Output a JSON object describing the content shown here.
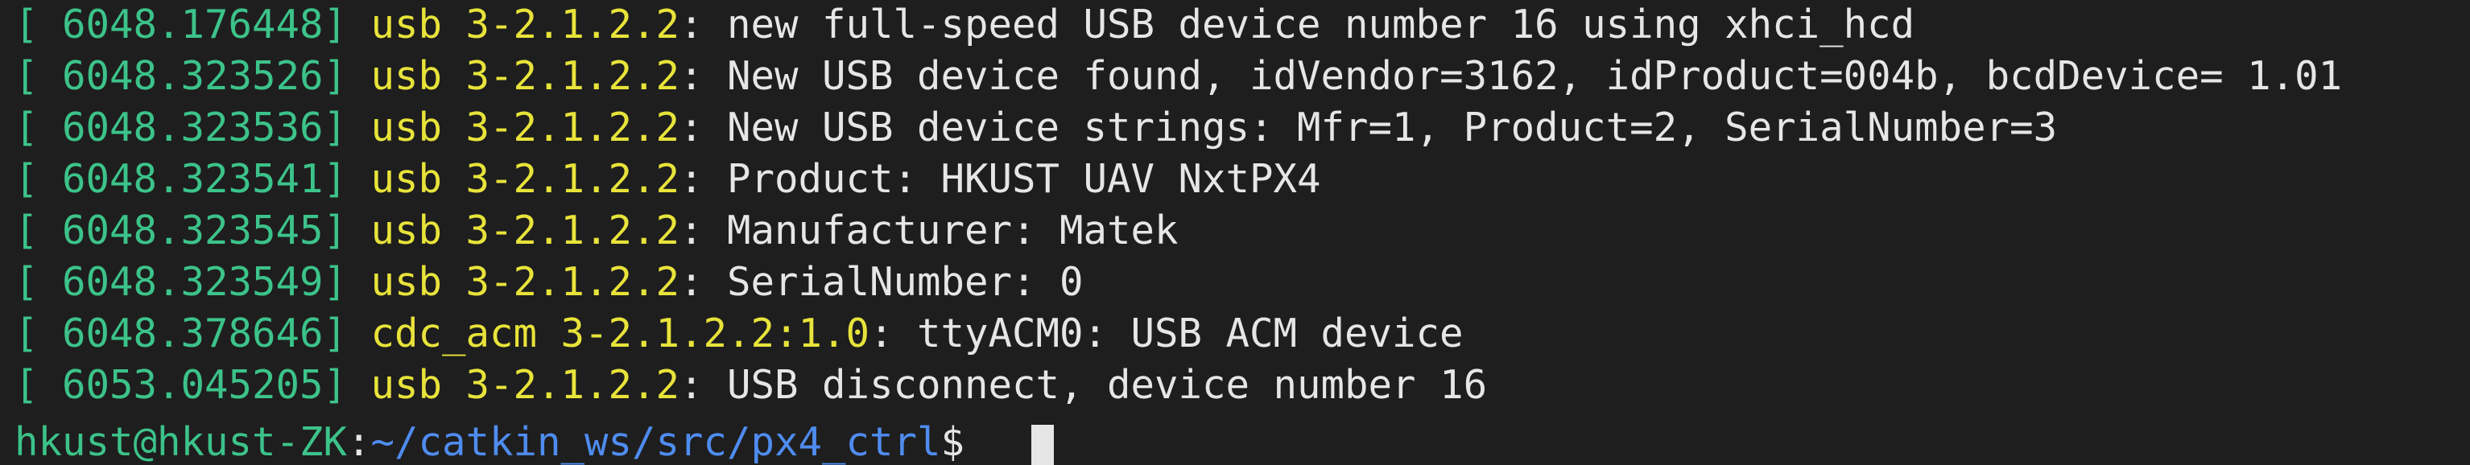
{
  "terminal": {
    "lines": [
      {
        "ts": "[ 6048.176448]",
        "dev": "usb 3-2.1.2.2",
        "msg": ": new full-speed USB device number 16 using xhci_hcd"
      },
      {
        "ts": "[ 6048.323526]",
        "dev": "usb 3-2.1.2.2",
        "msg": ": New USB device found, idVendor=3162, idProduct=004b, bcdDevice= 1.01"
      },
      {
        "ts": "[ 6048.323536]",
        "dev": "usb 3-2.1.2.2",
        "msg": ": New USB device strings: Mfr=1, Product=2, SerialNumber=3"
      },
      {
        "ts": "[ 6048.323541]",
        "dev": "usb 3-2.1.2.2",
        "msg": ": Product: HKUST UAV NxtPX4"
      },
      {
        "ts": "[ 6048.323545]",
        "dev": "usb 3-2.1.2.2",
        "msg": ": Manufacturer: Matek"
      },
      {
        "ts": "[ 6048.323549]",
        "dev": "usb 3-2.1.2.2",
        "msg": ": SerialNumber: 0"
      },
      {
        "ts": "[ 6048.378646]",
        "dev": "cdc_acm 3-2.1.2.2:1.0",
        "msg": ": ttyACM0: USB ACM device"
      },
      {
        "ts": "[ 6053.045205]",
        "dev": "usb 3-2.1.2.2",
        "msg": ": USB disconnect, device number 16"
      }
    ],
    "prompt": {
      "user": "hkust@hkust-ZK",
      "sep": ":",
      "path": "~/catkin_ws/src/px4_ctrl",
      "symbol": "$ "
    }
  }
}
